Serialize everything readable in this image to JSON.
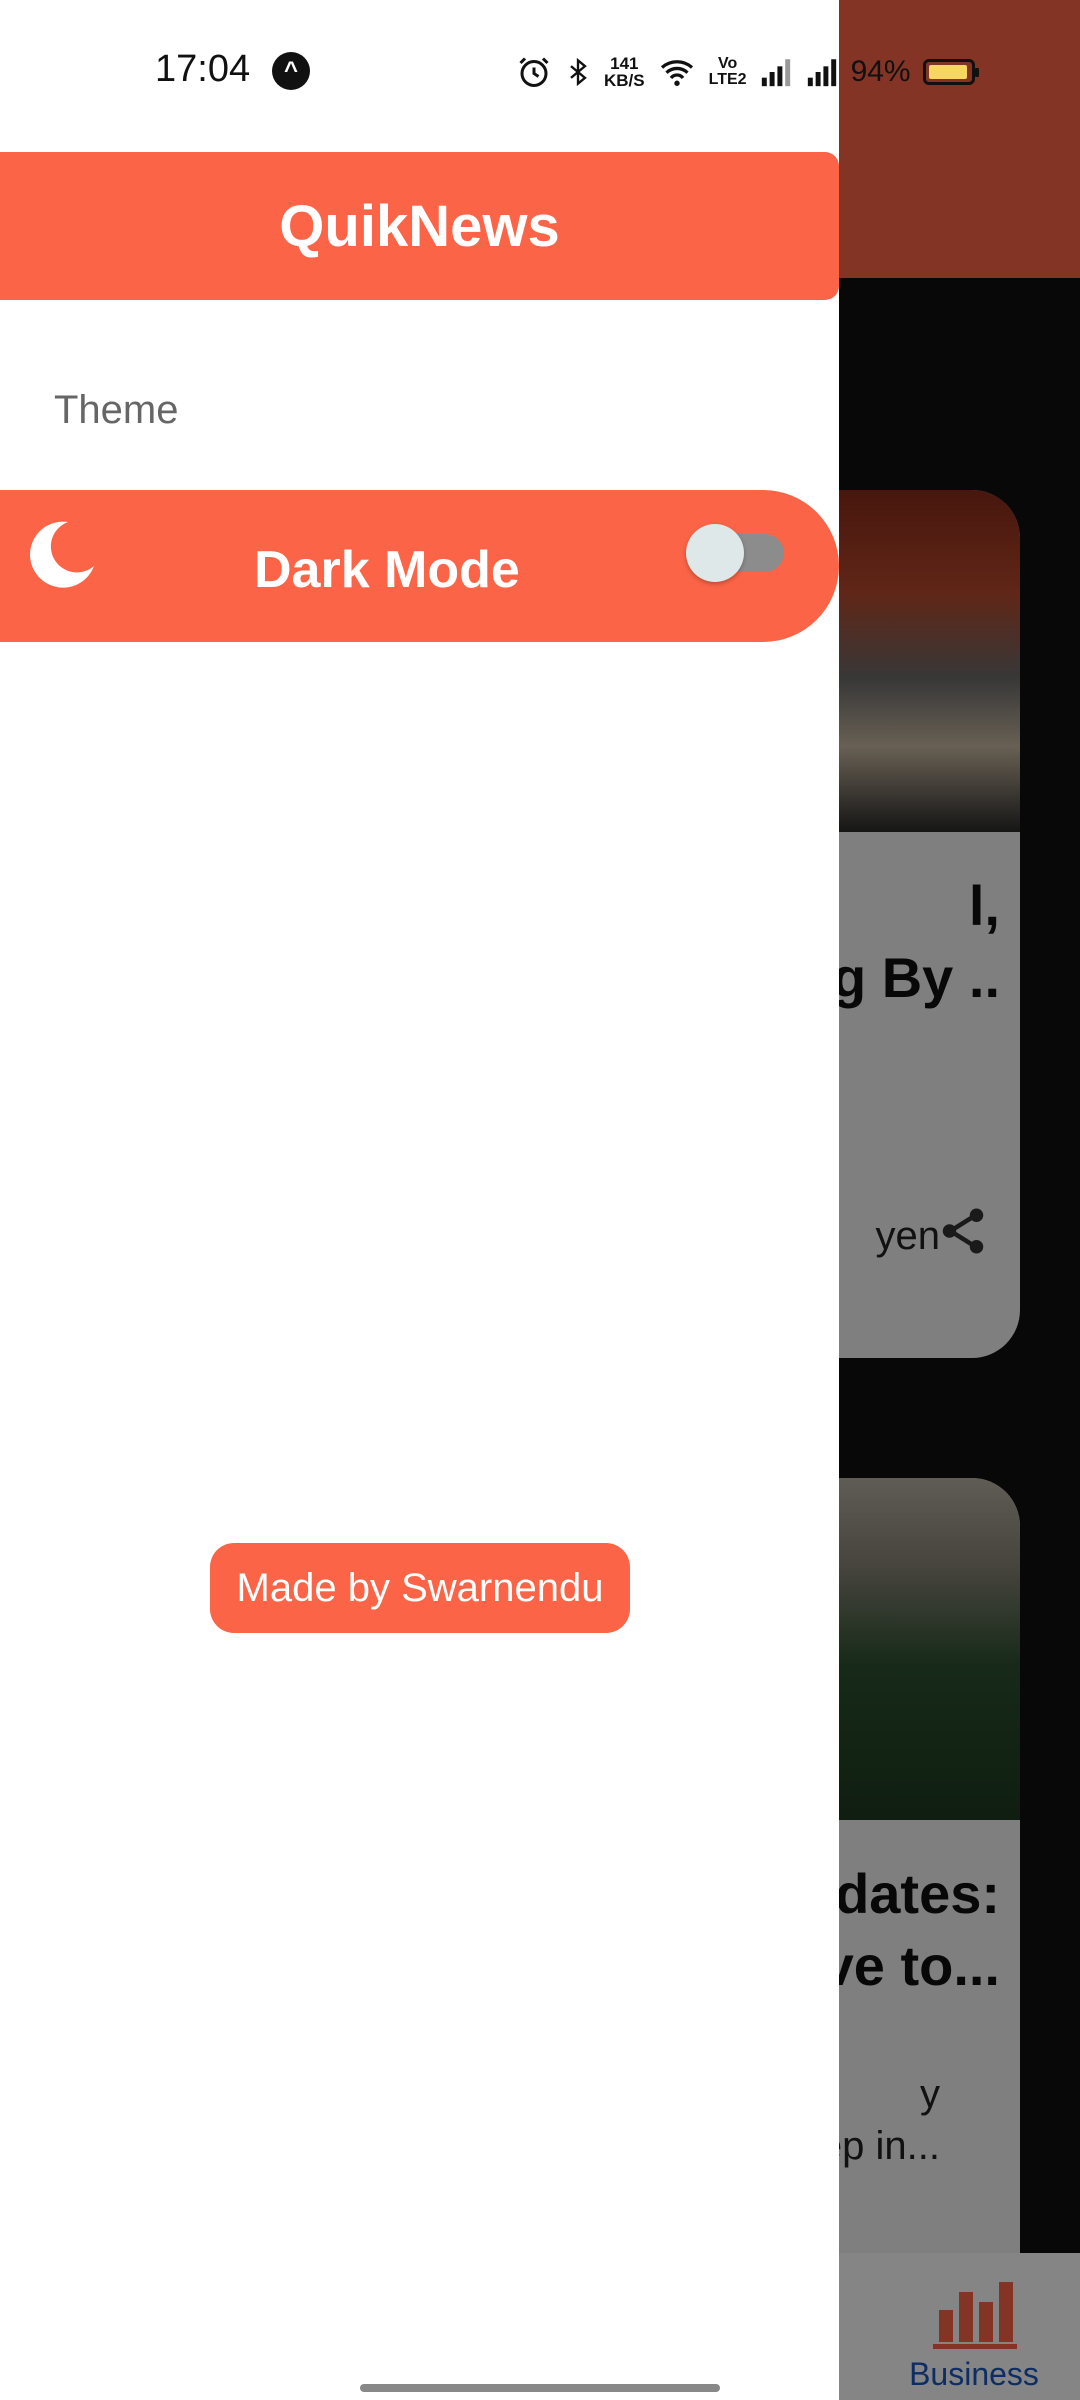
{
  "status_bar": {
    "time": "17:04",
    "speed_value": "141",
    "speed_unit": "KB/S",
    "volte_top": "Vo",
    "volte_bottom": "LTE2",
    "battery_pct": "94%"
  },
  "drawer": {
    "title": "QuikNews",
    "section_label": "Theme",
    "dark_mode_label": "Dark Mode",
    "dark_mode_enabled": false,
    "made_by": "Made by Swarnendu"
  },
  "background": {
    "card1": {
      "title_line1": "l,",
      "title_line2": "g By ..",
      "subtitle": "yen"
    },
    "card2": {
      "title_line1": "dates:",
      "title_line2": "ve to...",
      "sub_line1": "y",
      "sub_line2": "ep in..."
    },
    "bottom_nav_active": "Business"
  },
  "colors": {
    "accent": "#fb6447",
    "nav_active": "#1a56c2"
  },
  "icons": [
    "moon-icon",
    "share-icon",
    "bar-chart-icon",
    "alarm-icon",
    "bluetooth-icon",
    "wifi-icon",
    "signal-icon",
    "battery-icon"
  ]
}
